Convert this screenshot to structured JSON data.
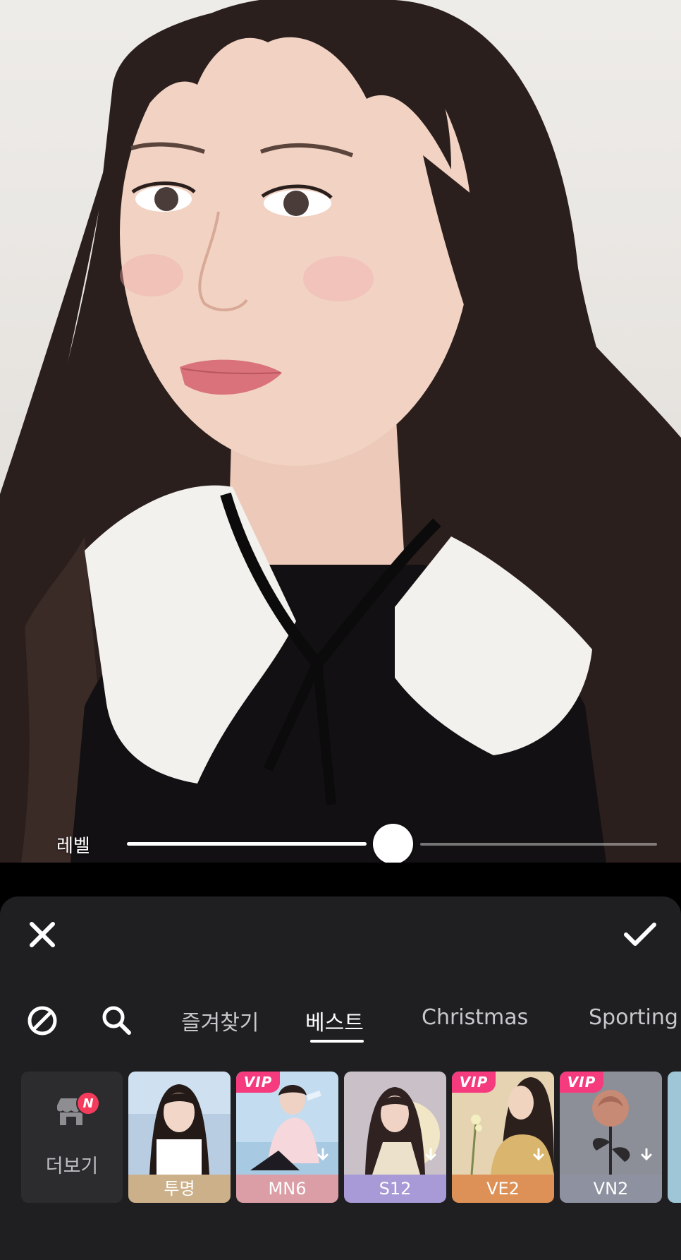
{
  "editor": {
    "slider": {
      "label": "레벨",
      "value_fraction": 0.5
    }
  },
  "toolbar": {
    "close_icon": "close-icon",
    "confirm_icon": "checkmark-icon"
  },
  "tabs": {
    "none_icon": "none-icon",
    "search_icon": "search-icon",
    "items": [
      {
        "label": "즐겨찾기",
        "active": false
      },
      {
        "label": "베스트",
        "active": true
      },
      {
        "label": "Christmas",
        "active": false
      },
      {
        "label": "Sporting",
        "active": false
      }
    ]
  },
  "filters": {
    "more": {
      "label": "더보기",
      "badge": "N"
    },
    "items": [
      {
        "label": "투명",
        "vip": false,
        "download": false,
        "color": "#cbb08a"
      },
      {
        "label": "MN6",
        "vip": true,
        "vip_label": "VIP",
        "download": true,
        "color": "#dc9ea6"
      },
      {
        "label": "S12",
        "vip": false,
        "download": true,
        "color": "#a79ad6"
      },
      {
        "label": "VE2",
        "vip": true,
        "vip_label": "VIP",
        "download": true,
        "color": "#de9157"
      },
      {
        "label": "VN2",
        "vip": true,
        "vip_label": "VIP",
        "download": true,
        "color": "#8e919f"
      }
    ]
  }
}
